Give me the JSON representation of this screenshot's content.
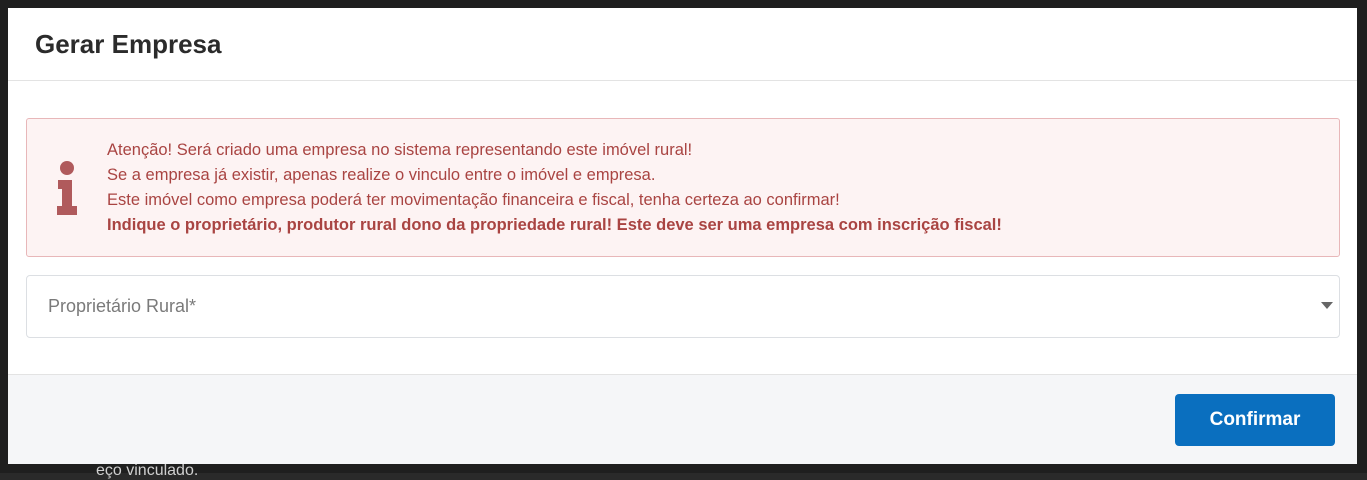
{
  "modal": {
    "title": "Gerar Empresa"
  },
  "alert": {
    "icon": "info-icon",
    "color": "#a94442",
    "lines": [
      "Atenção! Será criado uma empresa no sistema representando este imóvel rural!",
      "Se a empresa já existir, apenas realize o vinculo entre o imóvel e empresa.",
      "Este imóvel como empresa poderá ter movimentação financeira e fiscal, tenha certeza ao confirmar!",
      "Indique o proprietário, produtor rural dono da propriedade rural! Este deve ser uma empresa com inscrição fiscal!"
    ]
  },
  "owner_select": {
    "placeholder": "Proprietário Rural*",
    "icon": "chevron-down-icon"
  },
  "footer": {
    "confirm_label": "Confirmar",
    "confirm_color": "#0a6fbf"
  },
  "background": {
    "partial_text": "eço vinculado."
  }
}
